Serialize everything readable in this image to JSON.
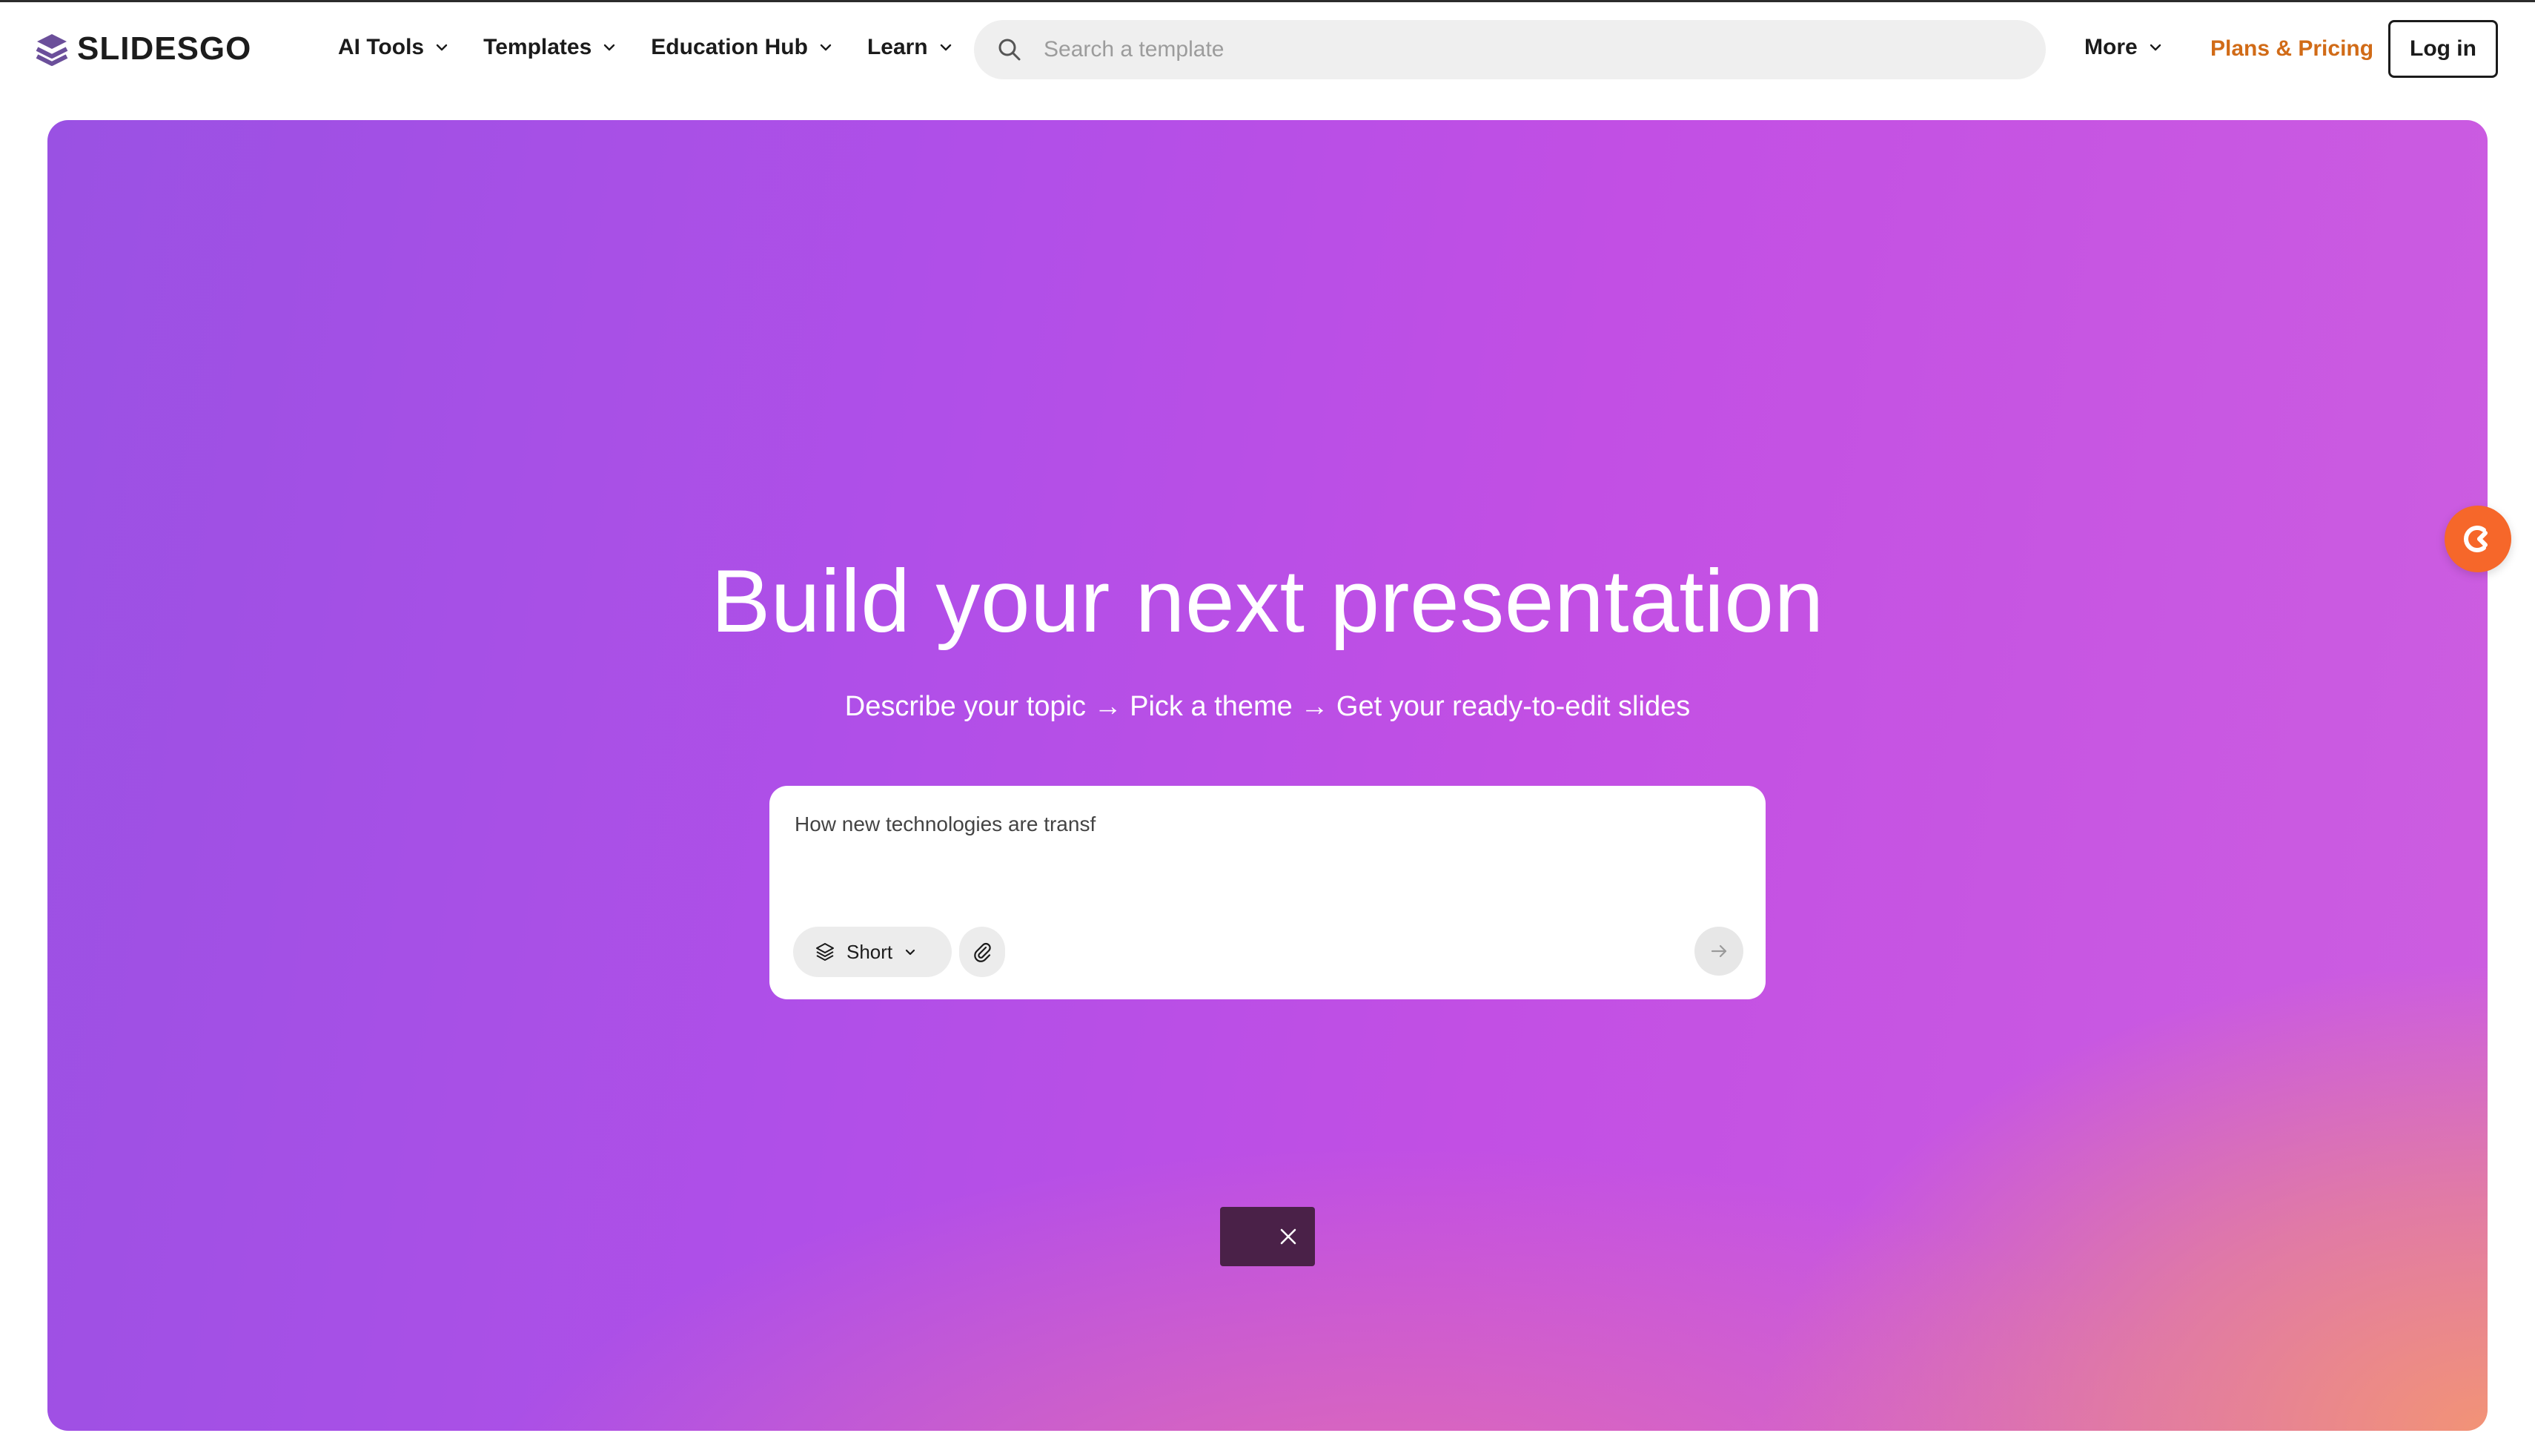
{
  "header": {
    "logo_text": "SLIDESGO",
    "nav": [
      {
        "label": "AI Tools"
      },
      {
        "label": "Templates"
      },
      {
        "label": "Education Hub"
      },
      {
        "label": "Learn"
      }
    ],
    "search_placeholder": "Search a template",
    "more_label": "More",
    "pricing_label": "Plans & Pricing",
    "login_label": "Log in"
  },
  "hero": {
    "title": "Build your next presentation",
    "subtitle": "Describe your topic → Pick a theme → Get your ready-to-edit slides",
    "prompt_value": "How new technologies are transf",
    "length_label": "Short"
  },
  "colors": {
    "brand_accent": "#d16b17",
    "float_button": "#f6672a",
    "toast_bg": "#4a2148",
    "logo": "#6b4f9a"
  },
  "icons": {
    "logo": "slidesgo-logo-icon",
    "search": "search-icon",
    "length": "layers-icon",
    "attach": "paperclip-icon",
    "send": "arrow-right-icon",
    "toast_close": "close-icon",
    "float": "refresh-icon"
  }
}
